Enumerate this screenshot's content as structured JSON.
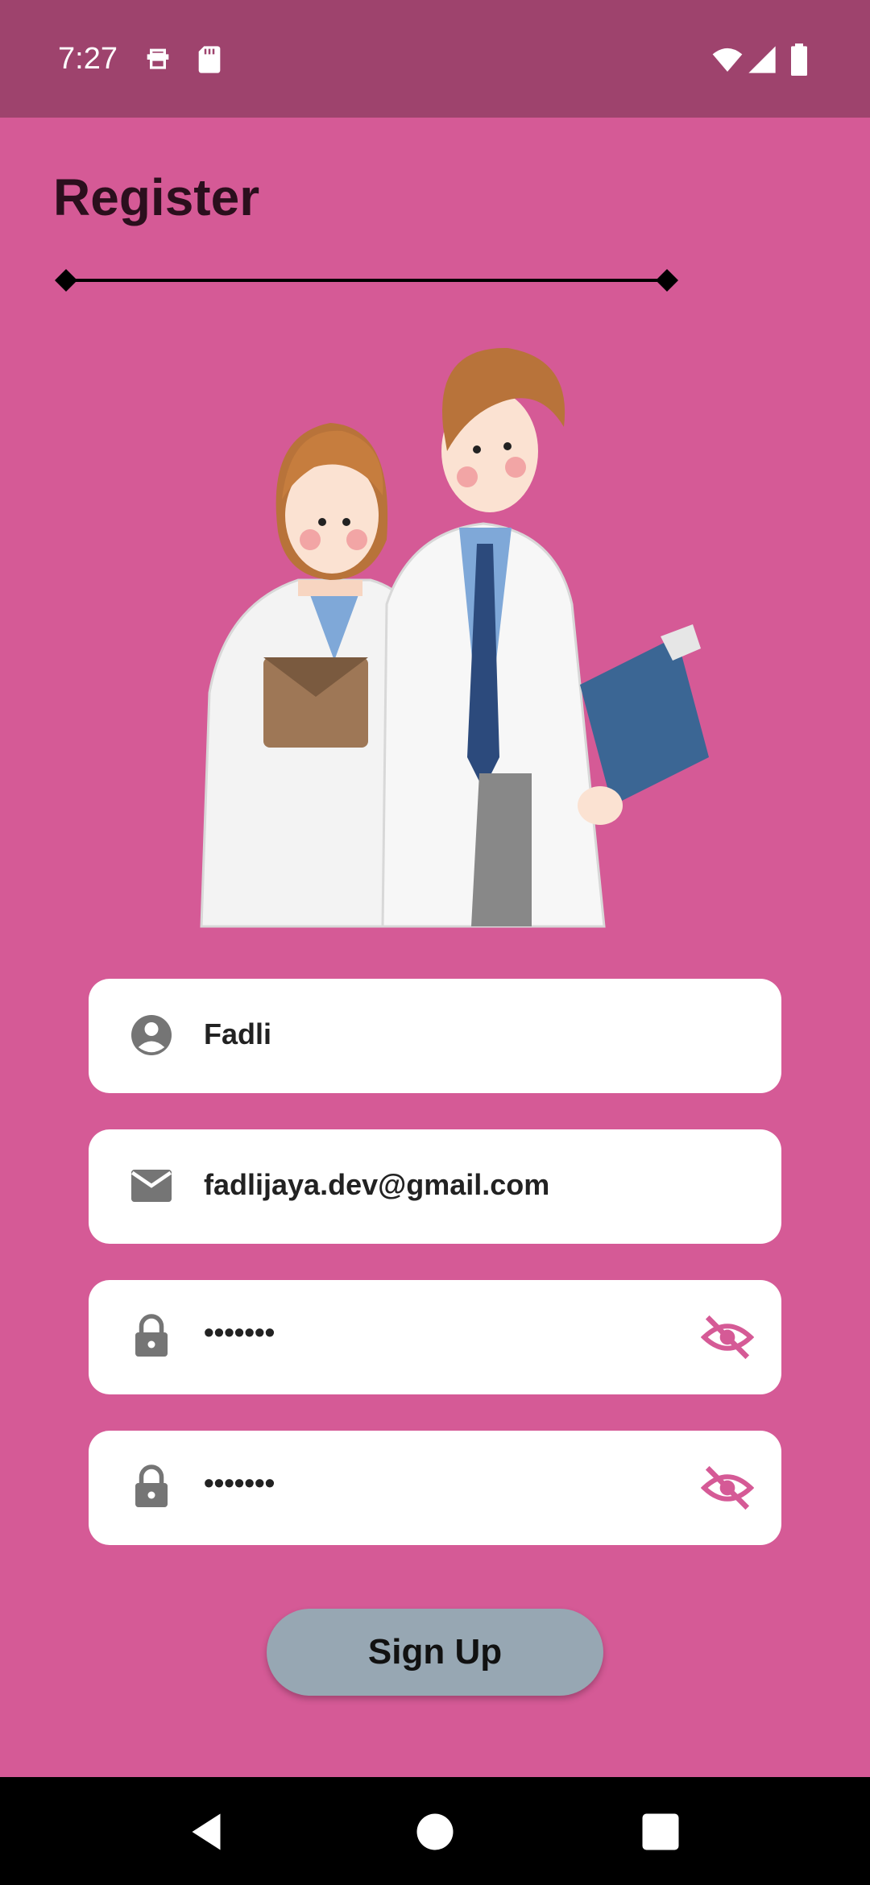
{
  "status_bar": {
    "time": "7:27",
    "left_icons": [
      "notification-icon",
      "sd-card-icon"
    ],
    "right_icons": [
      "wifi-icon",
      "signal-icon",
      "battery-icon"
    ]
  },
  "page": {
    "title": "Register"
  },
  "form": {
    "name": {
      "icon": "account-circle-icon",
      "value": "Fadli"
    },
    "email": {
      "icon": "mail-icon",
      "value": "fadlijaya.dev@gmail.com"
    },
    "password": {
      "icon": "lock-icon",
      "value": "•••••••",
      "toggle_icon": "eye-off-icon"
    },
    "confirm_password": {
      "icon": "lock-icon",
      "value": "•••••••",
      "toggle_icon": "eye-off-icon"
    }
  },
  "signup_button": {
    "label": "Sign Up"
  },
  "nav_bar": {
    "buttons": [
      "back-icon",
      "home-icon",
      "recents-icon"
    ]
  },
  "colors": {
    "background": "#d55a96",
    "status_bar": "#9e436d",
    "field_bg": "#ffffff",
    "button_bg": "#97a7b3",
    "eye_icon": "#d55a96"
  }
}
